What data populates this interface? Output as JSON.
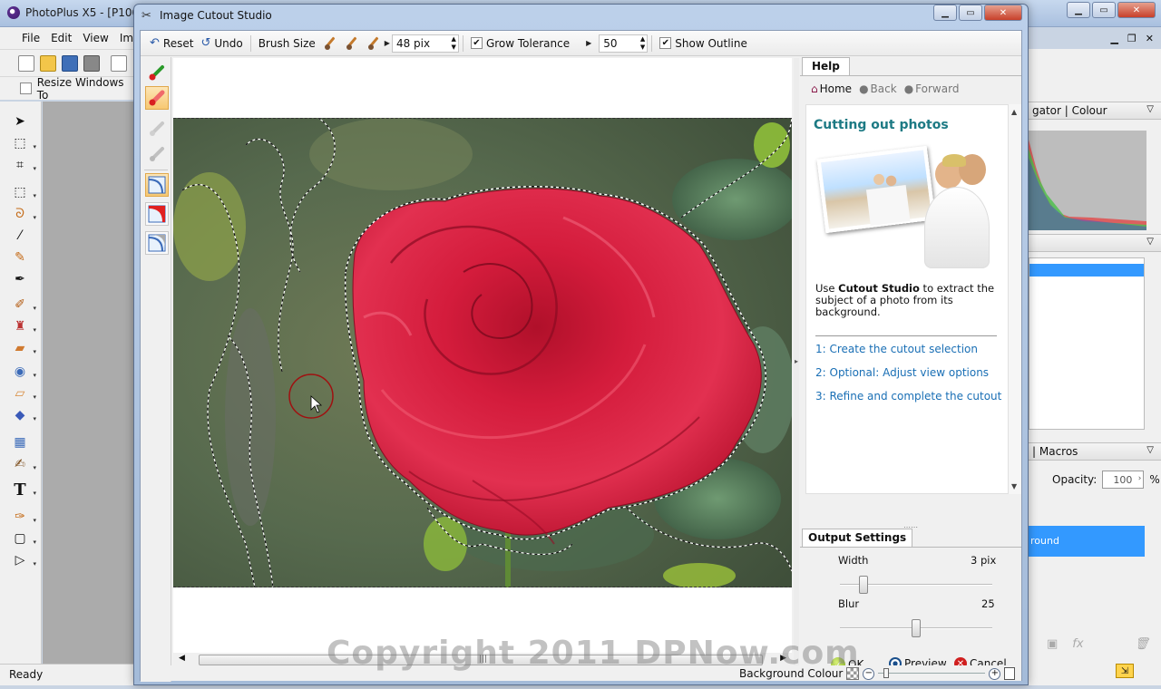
{
  "bg_app": {
    "title": "PhotoPlus X5 - [P1000",
    "menu": [
      "File",
      "Edit",
      "View",
      "Im"
    ],
    "context_checkbox_label": "Resize Windows To",
    "status": "Ready",
    "panels": {
      "navigator_header": "gator | Colour",
      "macros_header": "| Macros",
      "opacity_label": "Opacity:",
      "opacity_value": "100",
      "percent": "%",
      "layer_name": "round"
    }
  },
  "dialog": {
    "title": "Image Cutout Studio",
    "toolbar": {
      "reset": "Reset",
      "undo": "Undo",
      "brush_size_label": "Brush Size",
      "brush_size_value": "48 pix",
      "grow_tolerance_label": "Grow Tolerance",
      "grow_tolerance_value": "50",
      "show_outline_label": "Show Outline",
      "grow_tolerance_checked": true,
      "show_outline_checked": true
    },
    "help": {
      "tab": "Help",
      "nav": {
        "home": "Home",
        "back": "Back",
        "forward": "Forward"
      },
      "heading": "Cutting out photos",
      "para_pre": "Use ",
      "para_bold": "Cutout Studio",
      "para_post": " to extract the subject of a photo from its background.",
      "links": [
        "1: Create the cutout selection",
        "2: Optional: Adjust view options",
        "3: Refine and complete the cutout"
      ]
    },
    "output": {
      "tab": "Output Settings",
      "width_label": "Width",
      "width_value": "3 pix",
      "blur_label": "Blur",
      "blur_value": "25",
      "width_slider_fraction": 0.13,
      "blur_slider_fraction": 0.5,
      "ok": "OK",
      "preview": "Preview",
      "cancel": "Cancel"
    },
    "status": {
      "background_colour_label": "Background Colour"
    }
  },
  "watermark": "Copyright 2011 DPNow.com",
  "colors": {
    "accent_blue": "#3399ff",
    "help_heading": "#1d7a84",
    "link": "#1a6fb5"
  }
}
